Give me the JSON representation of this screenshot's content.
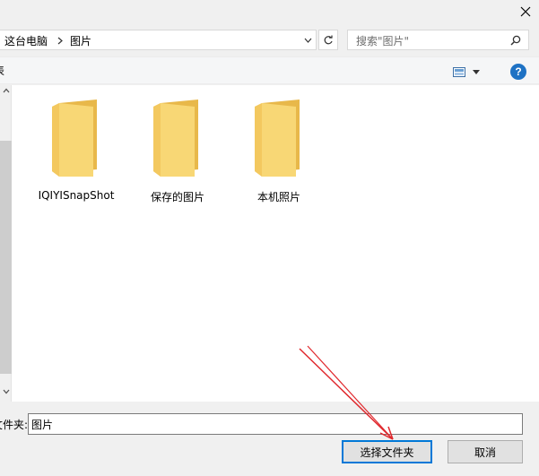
{
  "breadcrumb": {
    "items": [
      "这台电脑",
      "图片"
    ]
  },
  "search": {
    "placeholder": "搜索\"图片\""
  },
  "toolbar": {
    "clipped_label": "表"
  },
  "folders": [
    {
      "name": "IQIYISnapShot"
    },
    {
      "name": "保存的图片"
    },
    {
      "name": "本机照片"
    }
  ],
  "filename": {
    "label": "文件夹:",
    "value": "图片"
  },
  "buttons": {
    "select_folder": "选择文件夹",
    "cancel": "取消"
  },
  "colors": {
    "folder_body": "#f8d775",
    "folder_back": "#e8b84a",
    "accent": "#0078d7",
    "help": "#1e72c4",
    "annotation": "#e0282d"
  }
}
